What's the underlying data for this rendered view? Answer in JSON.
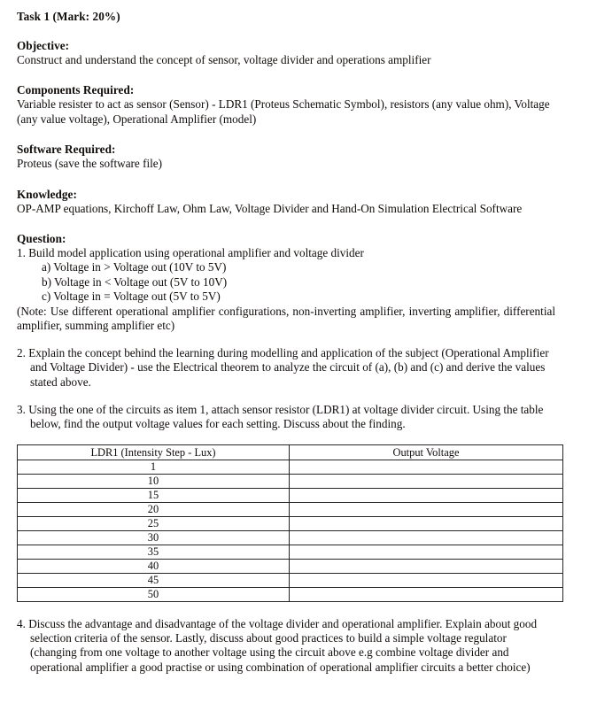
{
  "document": {
    "title": "Task 1 (Mark: 20%)",
    "sections": [
      {
        "heading": "Objective:",
        "body": "Construct and understand the concept of sensor, voltage divider and operations amplifier"
      },
      {
        "heading": "Components Required:",
        "body": "Variable resister to act as sensor (Sensor) - LDR1 (Proteus Schematic Symbol), resistors (any value ohm), Voltage (any value voltage), Operational Amplifier (model)"
      },
      {
        "heading": "Software Required:",
        "body": "Proteus (save the software file)"
      },
      {
        "heading": "Knowledge:",
        "body": "OP-AMP equations, Kirchoff Law, Ohm Law, Voltage Divider and Hand-On Simulation Electrical Software"
      }
    ],
    "question": {
      "heading": "Question:",
      "item1": "1. Build model application using operational amplifier and voltage divider",
      "sub_items": [
        "a) Voltage in > Voltage out (10V to 5V)",
        "b) Voltage in < Voltage out (5V to 10V)",
        "c) Voltage in = Voltage out (5V to 5V)"
      ],
      "note": "(Note: Use different operational amplifier configurations, non-inverting amplifier, inverting amplifier, differential amplifier, summing amplifier etc)",
      "item2": "2. Explain the concept behind the learning during modelling and application of the subject (Operational Amplifier and Voltage Divider) - use the Electrical theorem to analyze the circuit of (a), (b) and (c) and derive the values stated above.",
      "item3": "3. Using the one of the circuits as item 1, attach sensor resistor (LDR1) at voltage divider circuit. Using the table below, find the output voltage values for each setting. Discuss about the finding.",
      "item4": "4. Discuss the advantage and disadvantage of the voltage divider and operational amplifier. Explain about good selection criteria of the sensor. Lastly, discuss about good practices to build a simple voltage regulator (changing from one voltage to another voltage using the circuit above e.g combine voltage divider and operational amplifier a good practise or using combination of operational amplifier circuits a better choice)"
    },
    "table": {
      "headers": [
        "LDR1 (Intensity Step  - Lux)",
        "Output Voltage"
      ],
      "rows": [
        [
          "1",
          ""
        ],
        [
          "10",
          ""
        ],
        [
          "15",
          ""
        ],
        [
          "20",
          ""
        ],
        [
          "25",
          ""
        ],
        [
          "30",
          ""
        ],
        [
          "35",
          ""
        ],
        [
          "40",
          ""
        ],
        [
          "45",
          ""
        ],
        [
          "50",
          ""
        ]
      ]
    }
  }
}
